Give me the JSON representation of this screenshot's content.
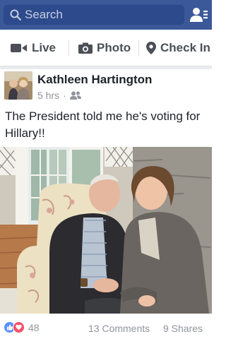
{
  "search": {
    "placeholder": "Search"
  },
  "composer": {
    "live_label": "Live",
    "photo_label": "Photo",
    "checkin_label": "Check In"
  },
  "post": {
    "author": "Kathleen Hartington",
    "time": "5 hrs",
    "audience_icon": "friends-icon",
    "text": "The President told me he's voting for Hillary!!",
    "photo_icon": "photo"
  },
  "footer": {
    "reaction_count": "48",
    "comments": "13 Comments",
    "shares": "9 Shares"
  },
  "colors": {
    "brand": "#3b5998",
    "like": "#5890ff",
    "love": "#f25268",
    "secondary_text": "#90949c"
  }
}
